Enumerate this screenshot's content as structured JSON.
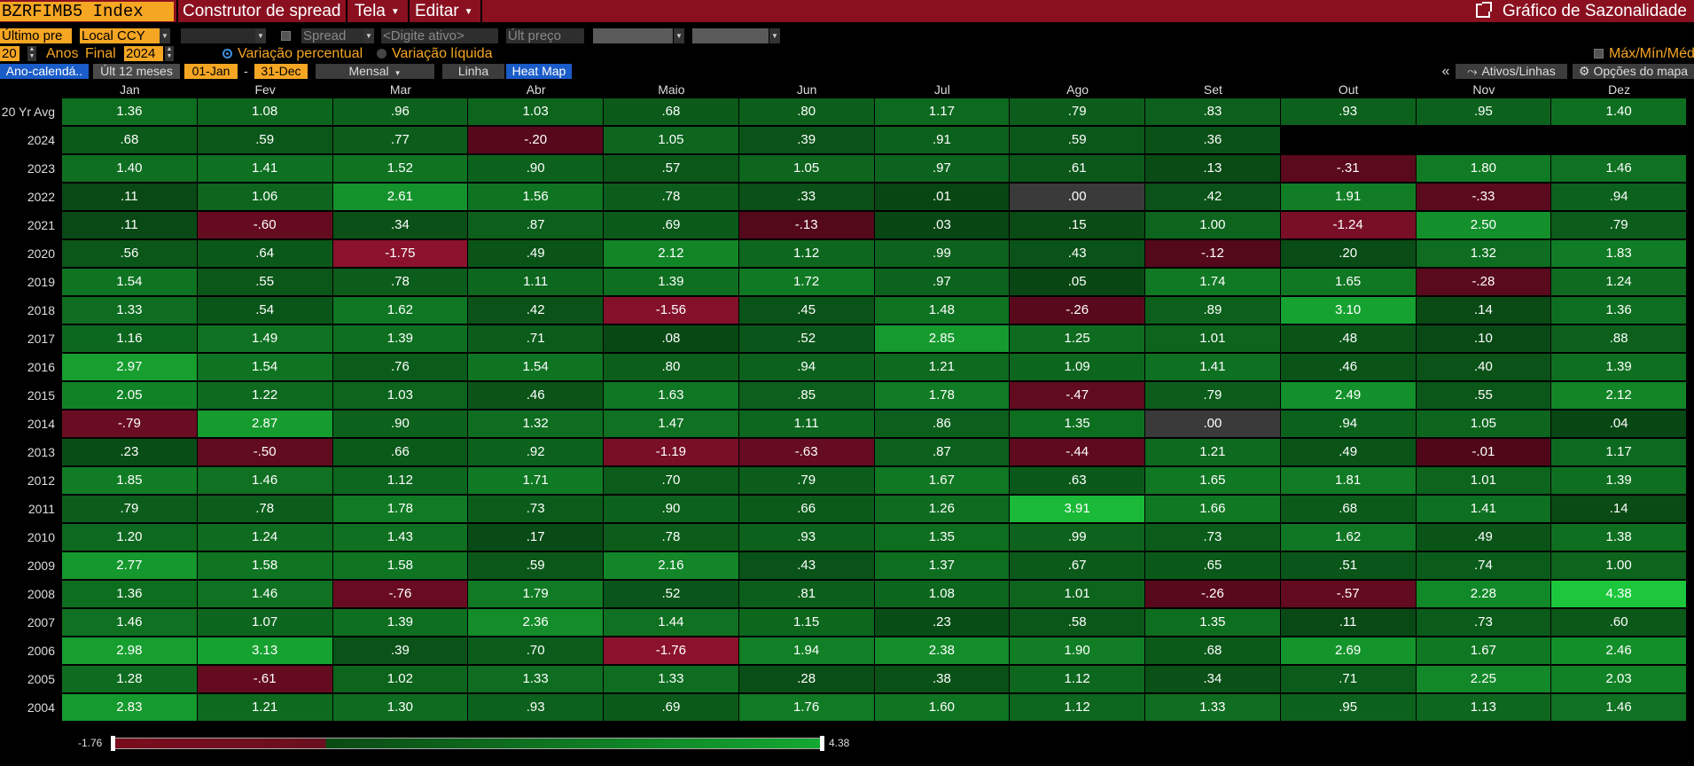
{
  "titlebar": {
    "security": "BZRFIMB5 Index",
    "menus": [
      "Construtor de spread",
      "Tela",
      "Editar"
    ],
    "seasonal_label": "Gráfico de Sazonalidade"
  },
  "toolbar1": {
    "field_price": "Último pre",
    "field_ccy": "Local CCY",
    "spread_label": "Spread",
    "asset_placeholder": "<Digite ativo>",
    "last_price": "Últ preço"
  },
  "toolbar2": {
    "years": "20",
    "years_label": "Anos",
    "final_label": "Final",
    "final_year": "2024",
    "radio_pct": "Variação percentual",
    "radio_net": "Variação líquida",
    "maxminmed": "Máx/Mín/Méd"
  },
  "toolbar3": {
    "calendar_year": "Ano-calendá..",
    "last12": "Últ 12 meses",
    "date_from": "01-Jan",
    "dash": "-",
    "date_to": "31-Dec",
    "monthly": "Mensal",
    "line": "Linha",
    "heatmap": "Heat Map",
    "collapse": "«",
    "assets_lines": "Ativos/Linhas",
    "map_options": "Opções do mapa"
  },
  "months": [
    "Jan",
    "Fev",
    "Mar",
    "Abr",
    "Maio",
    "Jun",
    "Jul",
    "Ago",
    "Set",
    "Out",
    "Nov",
    "Dez"
  ],
  "rows": [
    {
      "label": "20 Yr Avg",
      "values": [
        "1.36",
        "1.08",
        ".96",
        "1.03",
        ".68",
        ".80",
        "1.17",
        ".79",
        ".83",
        ".93",
        ".95",
        "1.40"
      ]
    },
    {
      "label": "2024",
      "values": [
        ".68",
        ".59",
        ".77",
        "-.20",
        "1.05",
        ".39",
        ".91",
        ".59",
        ".36",
        "",
        "",
        ""
      ]
    },
    {
      "label": "2023",
      "values": [
        "1.40",
        "1.41",
        "1.52",
        ".90",
        ".57",
        "1.05",
        ".97",
        ".61",
        ".13",
        "-.31",
        "1.80",
        "1.46"
      ]
    },
    {
      "label": "2022",
      "values": [
        ".11",
        "1.06",
        "2.61",
        "1.56",
        ".78",
        ".33",
        ".01",
        ".00",
        ".42",
        "1.91",
        "-.33",
        ".94"
      ]
    },
    {
      "label": "2021",
      "values": [
        ".11",
        "-.60",
        ".34",
        ".87",
        ".69",
        "-.13",
        ".03",
        ".15",
        "1.00",
        "-1.24",
        "2.50",
        ".79"
      ]
    },
    {
      "label": "2020",
      "values": [
        ".56",
        ".64",
        "-1.75",
        ".49",
        "2.12",
        "1.12",
        ".99",
        ".43",
        "-.12",
        ".20",
        "1.32",
        "1.83"
      ]
    },
    {
      "label": "2019",
      "values": [
        "1.54",
        ".55",
        ".78",
        "1.11",
        "1.39",
        "1.72",
        ".97",
        ".05",
        "1.74",
        "1.65",
        "-.28",
        "1.24"
      ]
    },
    {
      "label": "2018",
      "values": [
        "1.33",
        ".54",
        "1.62",
        ".42",
        "-1.56",
        ".45",
        "1.48",
        "-.26",
        ".89",
        "3.10",
        ".14",
        "1.36"
      ]
    },
    {
      "label": "2017",
      "values": [
        "1.16",
        "1.49",
        "1.39",
        ".71",
        ".08",
        ".52",
        "2.85",
        "1.25",
        "1.01",
        ".48",
        ".10",
        ".88"
      ]
    },
    {
      "label": "2016",
      "values": [
        "2.97",
        "1.54",
        ".76",
        "1.54",
        ".80",
        ".94",
        "1.21",
        "1.09",
        "1.41",
        ".46",
        ".40",
        "1.39"
      ]
    },
    {
      "label": "2015",
      "values": [
        "2.05",
        "1.22",
        "1.03",
        ".46",
        "1.63",
        ".85",
        "1.78",
        "-.47",
        ".79",
        "2.49",
        ".55",
        "2.12"
      ]
    },
    {
      "label": "2014",
      "values": [
        "-.79",
        "2.87",
        ".90",
        "1.32",
        "1.47",
        "1.11",
        ".86",
        "1.35",
        ".00",
        ".94",
        "1.05",
        ".04"
      ]
    },
    {
      "label": "2013",
      "values": [
        ".23",
        "-.50",
        ".66",
        ".92",
        "-1.19",
        "-.63",
        ".87",
        "-.44",
        "1.21",
        ".49",
        "-.01",
        "1.17"
      ]
    },
    {
      "label": "2012",
      "values": [
        "1.85",
        "1.46",
        "1.12",
        "1.71",
        ".70",
        ".79",
        "1.67",
        ".63",
        "1.65",
        "1.81",
        "1.01",
        "1.39"
      ]
    },
    {
      "label": "2011",
      "values": [
        ".79",
        ".78",
        "1.78",
        ".73",
        ".90",
        ".66",
        "1.26",
        "3.91",
        "1.66",
        ".68",
        "1.41",
        ".14"
      ]
    },
    {
      "label": "2010",
      "values": [
        "1.20",
        "1.24",
        "1.43",
        ".17",
        ".78",
        ".93",
        "1.35",
        ".99",
        ".73",
        "1.62",
        ".49",
        "1.38"
      ]
    },
    {
      "label": "2009",
      "values": [
        "2.77",
        "1.58",
        "1.58",
        ".59",
        "2.16",
        ".43",
        "1.37",
        ".67",
        ".65",
        ".51",
        ".74",
        "1.00"
      ]
    },
    {
      "label": "2008",
      "values": [
        "1.36",
        "1.46",
        "-.76",
        "1.79",
        ".52",
        ".81",
        "1.08",
        "1.01",
        "-.26",
        "-.57",
        "2.28",
        "4.38"
      ]
    },
    {
      "label": "2007",
      "values": [
        "1.46",
        "1.07",
        "1.39",
        "2.36",
        "1.44",
        "1.15",
        ".23",
        ".58",
        "1.35",
        ".11",
        ".73",
        ".60"
      ]
    },
    {
      "label": "2006",
      "values": [
        "2.98",
        "3.13",
        ".39",
        ".70",
        "-1.76",
        "1.94",
        "2.38",
        "1.90",
        ".68",
        "2.69",
        "1.67",
        "2.46"
      ]
    },
    {
      "label": "2005",
      "values": [
        "1.28",
        "-.61",
        "1.02",
        "1.33",
        "1.33",
        ".28",
        ".38",
        "1.12",
        ".34",
        ".71",
        "2.25",
        "2.03"
      ]
    },
    {
      "label": "2004",
      "values": [
        "2.83",
        "1.21",
        "1.30",
        ".93",
        ".69",
        "1.76",
        "1.60",
        "1.12",
        "1.33",
        ".95",
        "1.13",
        "1.46"
      ]
    }
  ],
  "legend": {
    "min": "-1.76",
    "max": "4.38"
  },
  "colors": {
    "title_bg": "#8a1020",
    "accent_orange": "#f5a623",
    "neg_red": "#7a0d1e",
    "neg_red_dark": "#5a0818",
    "zero_gray": "#3a3a3a",
    "pos_green_dark": "#0b4a14",
    "pos_green_bright": "#16b83a"
  }
}
